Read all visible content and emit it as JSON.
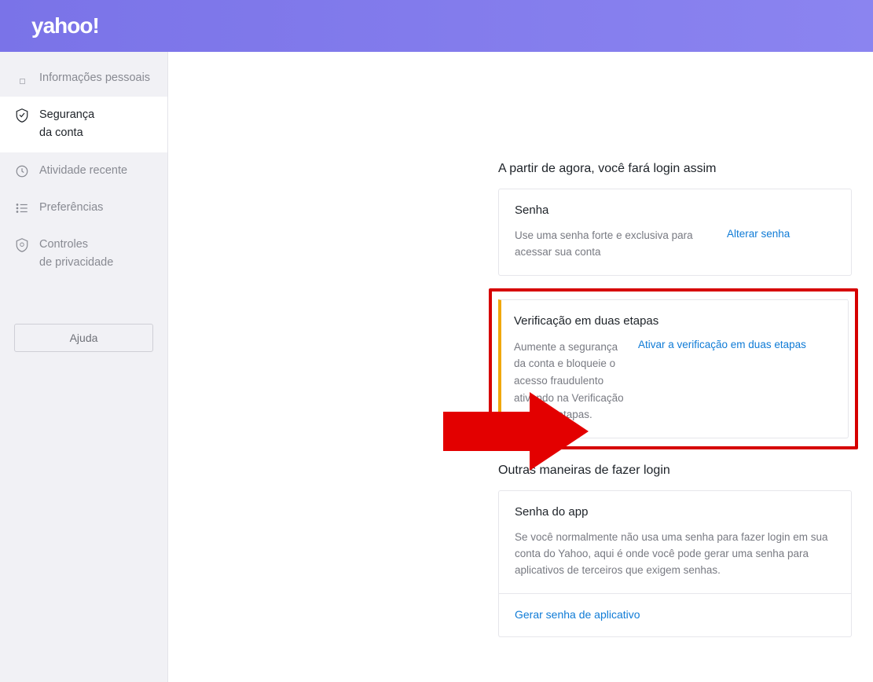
{
  "header": {
    "logo": "yahoo!"
  },
  "sidebar": {
    "items": [
      {
        "label": "Informações pessoais",
        "icon": "square-icon"
      },
      {
        "label": "Segurança\nda conta",
        "icon": "shield-icon"
      },
      {
        "label": "Atividade recente",
        "icon": "clock-icon"
      },
      {
        "label": "Preferências",
        "icon": "list-icon"
      },
      {
        "label": "Controles\nde privacidade",
        "icon": "shield-gear-icon"
      }
    ],
    "help_label": "Ajuda"
  },
  "main": {
    "section1_title": "A partir de agora, você fará login assim",
    "password_card": {
      "title": "Senha",
      "desc": "Use uma senha forte e exclusiva para acessar sua conta",
      "link": "Alterar senha"
    },
    "tsv_card": {
      "title": "Verificação em duas etapas",
      "desc": "Aumente a segurança da conta e bloqueie o acesso fraudulento ativando na Verificação em duas etapas.",
      "link": "Ativar a verificação em duas etapas"
    },
    "section2_title": "Outras maneiras de fazer login",
    "app_card": {
      "title": "Senha do app",
      "desc": "Se você normalmente não usa uma senha para fazer login em sua conta do Yahoo, aqui é onde você pode gerar uma senha para aplicativos de terceiros que exigem senhas.",
      "link": "Gerar senha de aplicativo"
    }
  },
  "colors": {
    "header_gradient_from": "#7a73e8",
    "header_gradient_to": "#8b84f0",
    "highlight_border": "#d60000",
    "tsv_accent": "#f0a80d",
    "link": "#0f7bd6"
  }
}
